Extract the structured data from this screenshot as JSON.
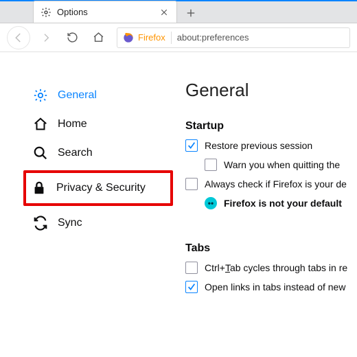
{
  "tab": {
    "title": "Options"
  },
  "urlbar": {
    "brand": "Firefox",
    "url": "about:preferences"
  },
  "sidebar": {
    "items": [
      {
        "label": "General"
      },
      {
        "label": "Home"
      },
      {
        "label": "Search"
      },
      {
        "label": "Privacy & Security"
      },
      {
        "label": "Sync"
      }
    ]
  },
  "main": {
    "heading": "General",
    "startup": {
      "title": "Startup",
      "restore": "Restore previous session",
      "warn_quit_prefix": "Warn you when quitting the ",
      "always_check": "Always check if Firefox is your de",
      "not_default": "Firefox is not your default "
    },
    "tabs": {
      "title": "Tabs",
      "ctrl_tab_pre": "Ctrl+",
      "ctrl_tab_u": "T",
      "ctrl_tab_post": "ab cycles through tabs in re",
      "open_links": "Open links in tabs instead of new"
    }
  }
}
